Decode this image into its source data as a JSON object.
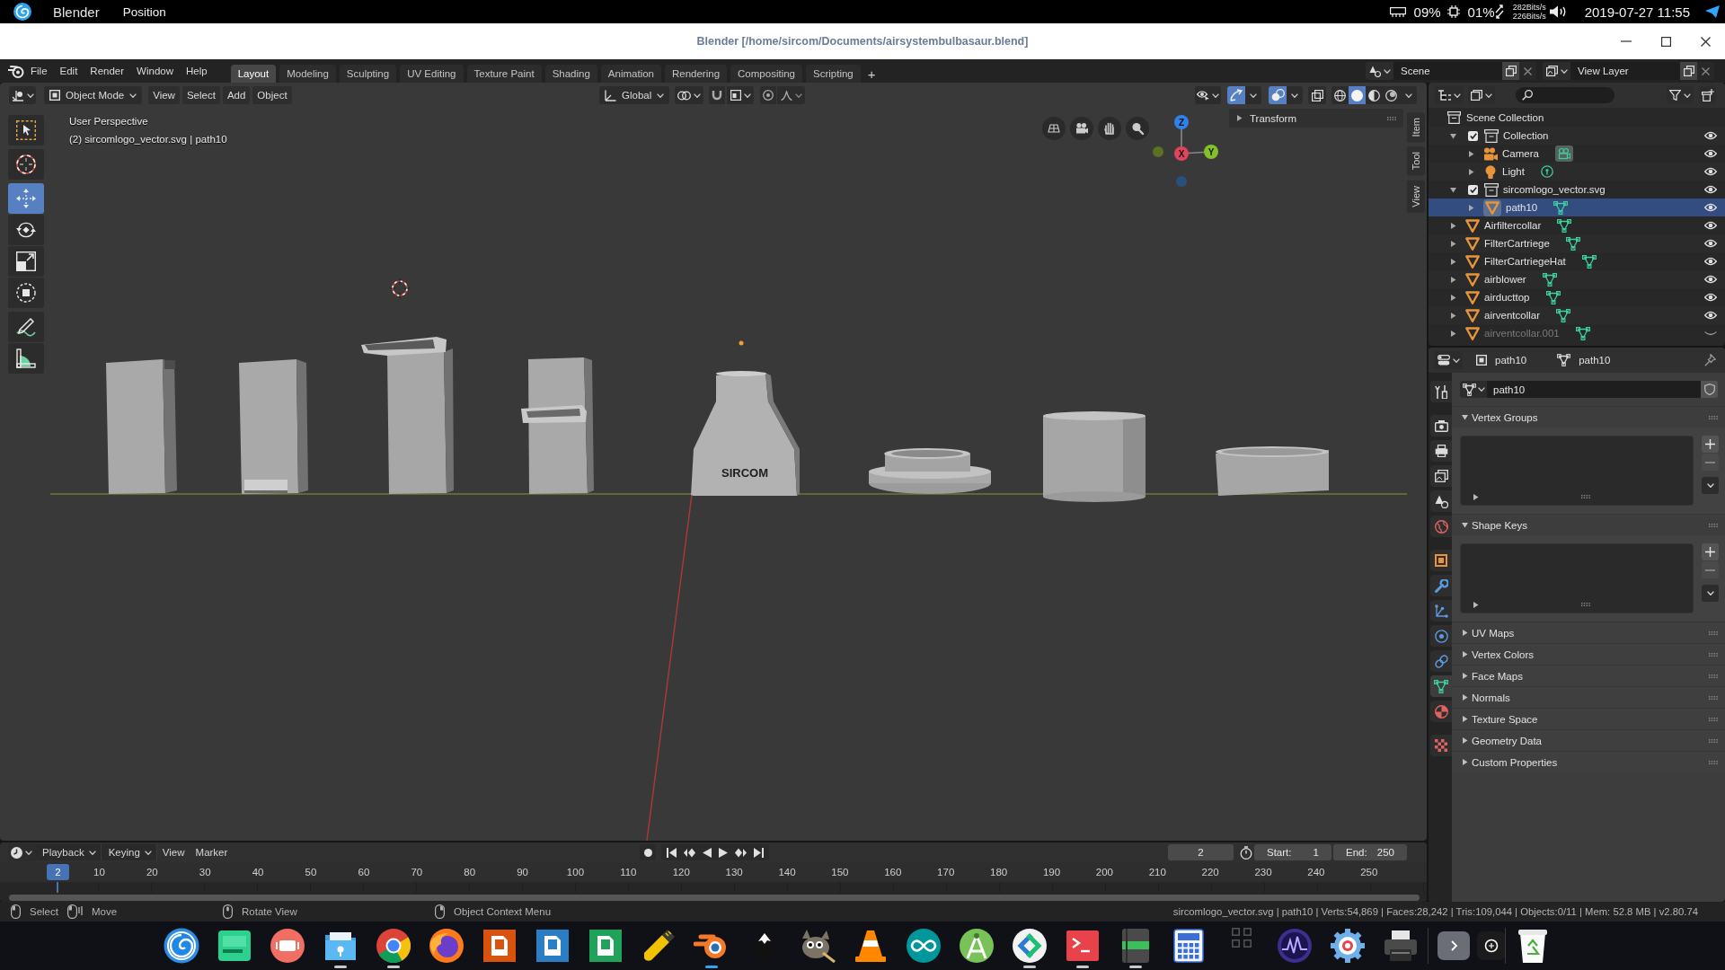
{
  "system_bar": {
    "app_name": "Blender",
    "menu": "Position",
    "indicators": [
      {
        "kind": "memory",
        "reading": "09%"
      },
      {
        "kind": "cpu",
        "reading": "01%"
      }
    ],
    "network": {
      "upload": "282Bits/s",
      "download": "226Bits/s"
    },
    "clock": "2019-07-27 11:55"
  },
  "window": {
    "title": "Blender [/home/sircom/Documents/airsystembulbasaur.blend]"
  },
  "top_bar": {
    "menus": [
      "File",
      "Edit",
      "Render",
      "Window",
      "Help"
    ],
    "workspace_tabs": [
      {
        "label": "Layout",
        "selected": true
      },
      {
        "label": "Modeling",
        "selected": false
      },
      {
        "label": "Sculpting",
        "selected": false
      },
      {
        "label": "UV Editing",
        "selected": false
      },
      {
        "label": "Texture Paint",
        "selected": false
      },
      {
        "label": "Shading",
        "selected": false
      },
      {
        "label": "Animation",
        "selected": false
      },
      {
        "label": "Rendering",
        "selected": false
      },
      {
        "label": "Compositing",
        "selected": false
      },
      {
        "label": "Scripting",
        "selected": false
      }
    ],
    "add_tab": "+",
    "scene": "Scene",
    "view_layer": "View Layer"
  },
  "viewport": {
    "mode": "Object Mode",
    "menus": [
      "View",
      "Select",
      "Add",
      "Object"
    ],
    "orientation": "Global",
    "snap": {
      "on": false
    },
    "proportional_editing": {
      "on": false
    },
    "gizmos": {
      "on": true
    },
    "overlays": {
      "on": true
    },
    "xray": {
      "on": false
    },
    "shading_modes": [
      {
        "kind": "wireframe",
        "selected": false
      },
      {
        "kind": "solid",
        "selected": true
      },
      {
        "kind": "material",
        "selected": false
      },
      {
        "kind": "rendered",
        "selected": false
      }
    ],
    "tool_groups": [
      [
        {
          "kind": "select_box",
          "selected": false
        }
      ],
      [
        {
          "kind": "cursor",
          "selected": false
        }
      ],
      [
        {
          "kind": "move",
          "selected": true
        },
        {
          "kind": "rotate",
          "selected": false
        },
        {
          "kind": "scale",
          "selected": false
        },
        {
          "kind": "transform",
          "selected": false
        }
      ],
      [
        {
          "kind": "annotate",
          "selected": false
        },
        {
          "kind": "measure",
          "selected": false
        }
      ]
    ],
    "view_name": "User Perspective",
    "object_info": "(2) sircomlogo_vector.svg | path10",
    "gizmo_axes": [
      "Z",
      "X",
      "Y"
    ],
    "transform_panel": {
      "title": "Transform",
      "expanded": false
    },
    "sidebar_tabs": [
      "Item",
      "Tool",
      "View"
    ],
    "model_logo": "SIRCOM"
  },
  "outliner": {
    "tree": {
      "label": "Scene Collection",
      "children": [
        {
          "label": "Collection",
          "kind": "collection",
          "checked": true,
          "expanded": true,
          "selected": false,
          "visible": true,
          "children": [
            {
              "label": "Camera",
              "kind": "camera",
              "expanded": false,
              "selected": false,
              "visible": true
            },
            {
              "label": "Light",
              "kind": "light",
              "expanded": false,
              "selected": false,
              "visible": true
            }
          ]
        },
        {
          "label": "sircomlogo_vector.svg",
          "kind": "collection",
          "checked": true,
          "expanded": true,
          "selected": false,
          "visible": true,
          "children": [
            {
              "label": "path10",
              "kind": "mesh",
              "expanded": false,
              "selected": true,
              "visible": true
            }
          ]
        },
        {
          "label": "Airfiltercollar",
          "kind": "mesh",
          "expanded": false,
          "selected": false,
          "visible": true
        },
        {
          "label": "FilterCartriege",
          "kind": "mesh",
          "expanded": false,
          "selected": false,
          "visible": true
        },
        {
          "label": "FilterCartriegeHat",
          "kind": "mesh",
          "expanded": false,
          "selected": false,
          "visible": true
        },
        {
          "label": "airblower",
          "kind": "mesh",
          "expanded": false,
          "selected": false,
          "visible": true
        },
        {
          "label": "airducttop",
          "kind": "mesh",
          "expanded": false,
          "selected": false,
          "visible": true
        },
        {
          "label": "airventcollar",
          "kind": "mesh",
          "expanded": false,
          "selected": false,
          "visible": true
        },
        {
          "label": "airventcollar.001",
          "kind": "mesh",
          "expanded": false,
          "selected": false,
          "visible": false
        }
      ]
    }
  },
  "properties": {
    "context": [
      {
        "kind": "object",
        "label": "path10"
      },
      {
        "kind": "mesh",
        "label": "path10"
      }
    ],
    "tabs": [
      {
        "kind": "tool",
        "selected": false
      },
      {
        "kind": "render",
        "selected": false
      },
      {
        "kind": "output",
        "selected": false
      },
      {
        "kind": "view_layer",
        "selected": false
      },
      {
        "kind": "scene",
        "selected": false
      },
      {
        "kind": "world",
        "selected": false
      },
      {
        "kind": "object",
        "selected": false
      },
      {
        "kind": "modifiers",
        "selected": false
      },
      {
        "kind": "particles",
        "selected": false
      },
      {
        "kind": "physics",
        "selected": false
      },
      {
        "kind": "constraints",
        "selected": false
      },
      {
        "kind": "data",
        "selected": true
      },
      {
        "kind": "material",
        "selected": false
      },
      {
        "kind": "texture",
        "selected": false
      }
    ],
    "datablock": "path10",
    "panels": [
      {
        "title": "Vertex Groups",
        "expanded": true
      },
      {
        "title": "Shape Keys",
        "expanded": true
      },
      {
        "title": "UV Maps",
        "expanded": false
      },
      {
        "title": "Vertex Colors",
        "expanded": false
      },
      {
        "title": "Face Maps",
        "expanded": false
      },
      {
        "title": "Normals",
        "expanded": false
      },
      {
        "title": "Texture Space",
        "expanded": false
      },
      {
        "title": "Geometry Data",
        "expanded": false
      },
      {
        "title": "Custom Properties",
        "expanded": false
      }
    ]
  },
  "timeline": {
    "menus": [
      {
        "label": "Playback",
        "kind": "dropdown"
      },
      {
        "label": "Keying",
        "kind": "dropdown"
      },
      {
        "label": "View",
        "kind": "menu"
      },
      {
        "label": "Marker",
        "kind": "menu"
      }
    ],
    "current_frame": "2",
    "start": {
      "label": "Start:",
      "value": "1"
    },
    "end": {
      "label": "End:",
      "value": "250"
    },
    "playhead": "2",
    "ruler": [
      "10",
      "20",
      "30",
      "40",
      "50",
      "60",
      "70",
      "80",
      "90",
      "100",
      "110",
      "120",
      "130",
      "140",
      "150",
      "160",
      "170",
      "180",
      "190",
      "200",
      "210",
      "220",
      "230",
      "240",
      "250"
    ]
  },
  "status_bar": {
    "hints": [
      {
        "kind": "left_click",
        "label": "Select"
      },
      {
        "kind": "left_drag",
        "label": "Move"
      },
      {
        "kind": "middle_click",
        "label": "Rotate View"
      },
      {
        "kind": "right_click",
        "label": "Object Context Menu"
      }
    ],
    "stats": "sircomlogo_vector.svg | path10 | Verts:54,869 | Faces:28,242 | Tris:109,044 | Objects:0/11 | Mem: 52.8 MB | v2.80.74"
  },
  "taskbar": {
    "apps": [
      {
        "kind": "swirl",
        "running": false,
        "focused": false
      },
      {
        "kind": "board",
        "running": false,
        "focused": false
      },
      {
        "kind": "record",
        "running": false,
        "focused": false
      },
      {
        "kind": "folder",
        "running": true,
        "focused": false
      },
      {
        "kind": "ring",
        "running": true,
        "focused": false
      },
      {
        "kind": "fox",
        "running": false,
        "focused": false
      },
      {
        "kind": "slides",
        "running": false,
        "focused": false
      },
      {
        "kind": "doc",
        "running": false,
        "focused": false
      },
      {
        "kind": "sheet",
        "running": false,
        "focused": false
      },
      {
        "kind": "usb",
        "running": false,
        "focused": false
      },
      {
        "kind": "orbit",
        "running": true,
        "focused": true
      },
      {
        "kind": "ink",
        "running": false,
        "focused": false
      },
      {
        "kind": "gnu",
        "running": false,
        "focused": false
      },
      {
        "kind": "cone",
        "running": false,
        "focused": false
      },
      {
        "kind": "infinity",
        "running": false,
        "focused": false
      },
      {
        "kind": "droid",
        "running": false,
        "focused": false
      },
      {
        "kind": "arrows",
        "running": true,
        "focused": false
      },
      {
        "kind": "terminal",
        "running": true,
        "focused": false
      },
      {
        "kind": "notebook",
        "running": true,
        "focused": false
      },
      {
        "kind": "calculator",
        "running": false,
        "focused": false
      },
      {
        "kind": "grid",
        "running": false,
        "focused": false
      },
      {
        "kind": "monitor",
        "running": false,
        "focused": false
      },
      {
        "kind": "gear",
        "running": false,
        "focused": false
      },
      {
        "kind": "printer",
        "running": false,
        "focused": false
      }
    ]
  }
}
